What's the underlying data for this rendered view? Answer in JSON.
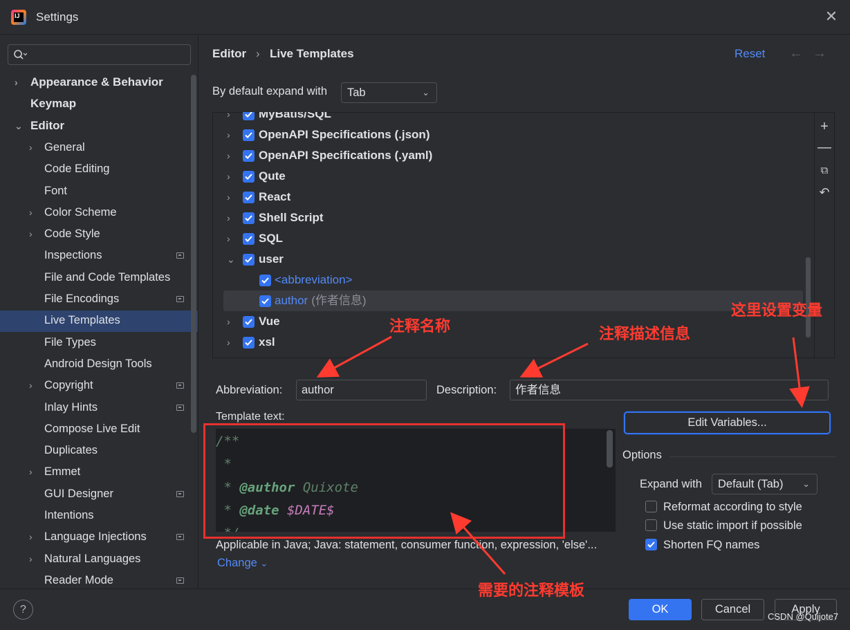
{
  "window": {
    "title": "Settings"
  },
  "sidebar": {
    "search_placeholder": "",
    "items": [
      {
        "label": "Appearance & Behavior",
        "level": 0,
        "arrow": "›",
        "badge": false
      },
      {
        "label": "Keymap",
        "level": 0,
        "arrow": "",
        "badge": false
      },
      {
        "label": "Editor",
        "level": 0,
        "arrow": "⌄",
        "badge": false
      },
      {
        "label": "General",
        "level": 1,
        "arrow": "›",
        "badge": false
      },
      {
        "label": "Code Editing",
        "level": 1,
        "arrow": "",
        "badge": false
      },
      {
        "label": "Font",
        "level": 1,
        "arrow": "",
        "badge": false
      },
      {
        "label": "Color Scheme",
        "level": 1,
        "arrow": "›",
        "badge": false
      },
      {
        "label": "Code Style",
        "level": 1,
        "arrow": "›",
        "badge": false
      },
      {
        "label": "Inspections",
        "level": 1,
        "arrow": "",
        "badge": true
      },
      {
        "label": "File and Code Templates",
        "level": 1,
        "arrow": "",
        "badge": false
      },
      {
        "label": "File Encodings",
        "level": 1,
        "arrow": "",
        "badge": true
      },
      {
        "label": "Live Templates",
        "level": 1,
        "arrow": "",
        "badge": false,
        "selected": true
      },
      {
        "label": "File Types",
        "level": 1,
        "arrow": "",
        "badge": false
      },
      {
        "label": "Android Design Tools",
        "level": 1,
        "arrow": "",
        "badge": false
      },
      {
        "label": "Copyright",
        "level": 1,
        "arrow": "›",
        "badge": true
      },
      {
        "label": "Inlay Hints",
        "level": 1,
        "arrow": "",
        "badge": true
      },
      {
        "label": "Compose Live Edit",
        "level": 1,
        "arrow": "",
        "badge": false
      },
      {
        "label": "Duplicates",
        "level": 1,
        "arrow": "",
        "badge": false
      },
      {
        "label": "Emmet",
        "level": 1,
        "arrow": "›",
        "badge": false
      },
      {
        "label": "GUI Designer",
        "level": 1,
        "arrow": "",
        "badge": true
      },
      {
        "label": "Intentions",
        "level": 1,
        "arrow": "",
        "badge": false
      },
      {
        "label": "Language Injections",
        "level": 1,
        "arrow": "›",
        "badge": true
      },
      {
        "label": "Natural Languages",
        "level": 1,
        "arrow": "›",
        "badge": false
      },
      {
        "label": "Reader Mode",
        "level": 1,
        "arrow": "",
        "badge": true
      }
    ]
  },
  "header": {
    "breadcrumb_parent": "Editor",
    "breadcrumb_sep": "›",
    "breadcrumb_current": "Live Templates",
    "reset": "Reset",
    "back": "←",
    "forward": "→"
  },
  "expand": {
    "label": "By default expand with",
    "value": "Tab"
  },
  "templates": {
    "groups": [
      {
        "name": "MyBatis/SQL",
        "expanded": false,
        "checked": true,
        "partial": true
      },
      {
        "name": "OpenAPI Specifications (.json)",
        "expanded": false,
        "checked": true
      },
      {
        "name": "OpenAPI Specifications (.yaml)",
        "expanded": false,
        "checked": true
      },
      {
        "name": "Qute",
        "expanded": false,
        "checked": true
      },
      {
        "name": "React",
        "expanded": false,
        "checked": true
      },
      {
        "name": "Shell Script",
        "expanded": false,
        "checked": true
      },
      {
        "name": "SQL",
        "expanded": false,
        "checked": true
      },
      {
        "name": "user",
        "expanded": true,
        "checked": true
      },
      {
        "name": "<abbreviation>",
        "child": true,
        "checked": true,
        "desc": ""
      },
      {
        "name": "author",
        "child": true,
        "checked": true,
        "desc": "(作者信息)",
        "selected": true
      },
      {
        "name": "Vue",
        "expanded": false,
        "checked": true
      },
      {
        "name": "xsl",
        "expanded": false,
        "checked": true
      }
    ],
    "toolbar": [
      "add-icon",
      "remove-icon",
      "copy-icon",
      "restore-icon"
    ]
  },
  "fields": {
    "abbreviation_label": "Abbreviation:",
    "abbreviation_value": "author",
    "description_label": "Description:",
    "description_value": "作者信息",
    "template_text_label": "Template text:",
    "edit_variables": "Edit Variables..."
  },
  "template_text": {
    "lines": [
      "/**",
      " *",
      " * @author Quixote",
      " * @date $DATE$",
      " */"
    ]
  },
  "applicable": "Applicable in Java; Java: statement, consumer function, expression, 'else'...",
  "change": "Change",
  "options": {
    "title": "Options",
    "expand_with_label": "Expand with",
    "expand_with_value": "Default (Tab)",
    "reformat": {
      "label": "Reformat according to style",
      "checked": false
    },
    "static_import": {
      "label": "Use static import if possible",
      "checked": false
    },
    "shorten_fq": {
      "label": "Shorten FQ names",
      "checked": true
    }
  },
  "buttons": {
    "help": "?",
    "ok": "OK",
    "cancel": "Cancel",
    "apply": "Apply"
  },
  "watermark": "CSDN @Quijote7",
  "annotations": {
    "name": "注释名称",
    "description": "注释描述信息",
    "variables": "这里设置变量",
    "template": "需要的注释模板",
    "color": "#ff3b30"
  },
  "colors": {
    "accent": "#3574f0",
    "link": "#548af7",
    "selection": "#2e436e"
  }
}
